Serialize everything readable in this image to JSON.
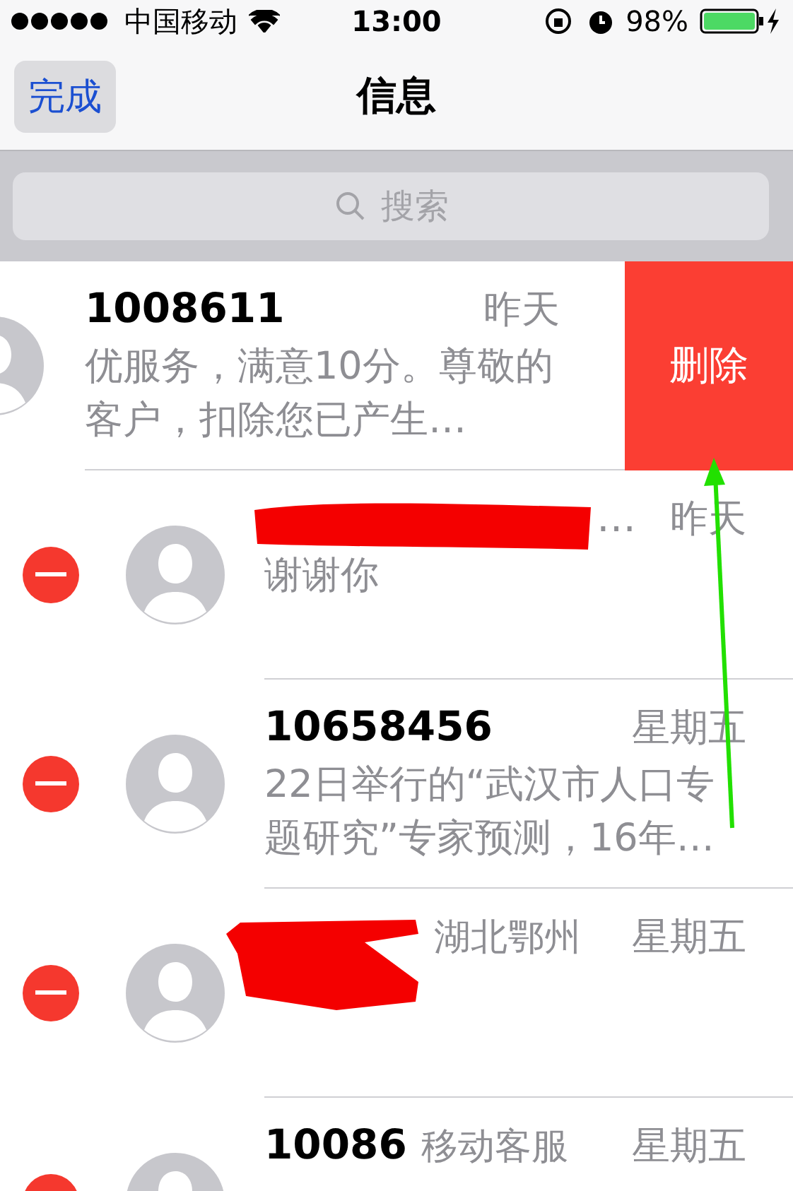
{
  "status_bar": {
    "carrier": "中国移动",
    "time": "13:00",
    "battery": "98%"
  },
  "nav": {
    "done_button": "完成",
    "done_pressed": true,
    "title": "信息"
  },
  "search": {
    "placeholder": "搜索"
  },
  "conversations": [
    {
      "kind": "swiped",
      "name": "1008611",
      "time": "昨天",
      "preview": "优服务，满意10分。尊敬的客户，扣除您已产生…",
      "delete_label": "删除",
      "redacted": false
    },
    {
      "kind": "editing",
      "name": "…",
      "time": "昨天",
      "preview": "谢谢你",
      "redacted": true
    },
    {
      "kind": "editing",
      "name": "10658456",
      "time": "星期五",
      "preview": "22日举行的“武汉市人口专题研究”专家预测，16年…",
      "redacted": false
    },
    {
      "kind": "editing",
      "name": "湖北鄂州",
      "time": "星期五",
      "redacted": true
    },
    {
      "kind": "editing",
      "name": "10086",
      "label": "移动客服",
      "time": "星期五",
      "redacted": false
    }
  ]
}
